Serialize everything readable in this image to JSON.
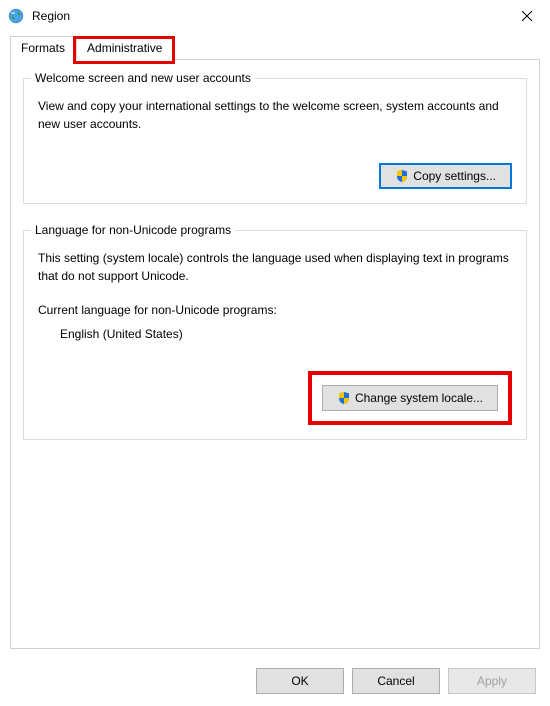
{
  "window": {
    "title": "Region"
  },
  "tabs": {
    "formats": "Formats",
    "administrative": "Administrative"
  },
  "welcome_section": {
    "legend": "Welcome screen and new user accounts",
    "description": "View and copy your international settings to the welcome screen, system accounts and new user accounts.",
    "copy_button": "Copy settings..."
  },
  "nonunicode_section": {
    "legend": "Language for non-Unicode programs",
    "description": "This setting (system locale) controls the language used when displaying text in programs that do not support Unicode.",
    "current_label": "Current language for non-Unicode programs:",
    "current_value": "English (United States)",
    "change_button": "Change system locale..."
  },
  "buttons": {
    "ok": "OK",
    "cancel": "Cancel",
    "apply": "Apply"
  }
}
